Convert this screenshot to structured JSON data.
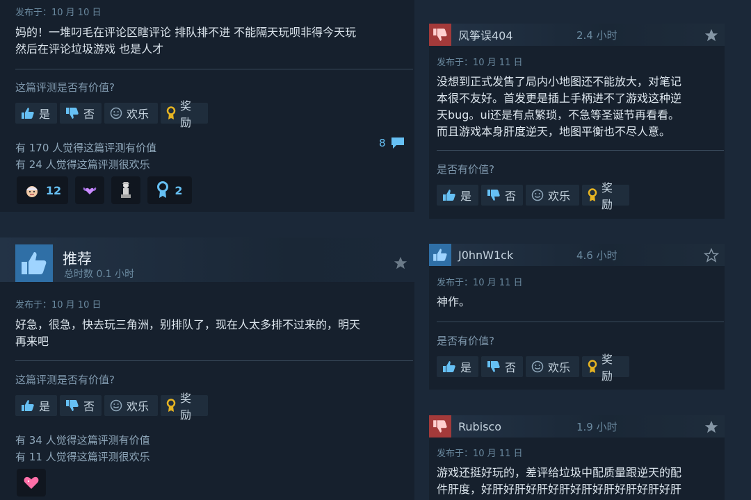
{
  "common": {
    "helpful_question": "这篇评测是否有价值?",
    "helpful_question_short": "是否有价值?",
    "btn_yes": "是",
    "btn_no": "否",
    "btn_funny": "欢乐",
    "btn_award": "奖励"
  },
  "left_review_1": {
    "posted": "发布于：10 月 10 日",
    "text_line1": "妈的！一堆叼毛在评论区瞎评论 排队排不进 不能隔天玩呗非得今天玩",
    "text_line2": "然后在评论垃圾游戏 也是人才",
    "helpful_count": "有 170 人觉得这篇评测有价值",
    "funny_count": "有 24 人觉得这篇评测很欢乐",
    "comment_count": "8",
    "awards": [
      {
        "icon": "face-award-icon",
        "count": "12"
      },
      {
        "icon": "heart-wings-award-icon",
        "count": ""
      },
      {
        "icon": "statue-award-icon",
        "count": ""
      },
      {
        "icon": "ribbon-award-icon",
        "count": "2"
      }
    ]
  },
  "left_review_2": {
    "verdict": "推荐",
    "hours": "总时数 0.1 小时",
    "posted": "发布于：10 月 10 日",
    "text_line1": "好急，很急，快去玩三角洲，别排队了，现在人太多排不过来的，明天",
    "text_line2": "再来吧",
    "helpful_count": "有 34 人觉得这篇评测有价值",
    "funny_count": "有 11 人觉得这篇评测很欢乐",
    "awards": [
      {
        "icon": "heart-award-icon",
        "count": ""
      }
    ]
  },
  "right_review_1": {
    "user": "风筝误404",
    "hours": "2.4 小时",
    "posted": "发布于：10 月 11 日",
    "text_line1": "没想到正式发售了局内小地图还不能放大，对笔记",
    "text_line2": "本很不友好。首发更是插上手柄进不了游戏这种逆",
    "text_line3": "天bug。ui还是有点繁琐，不急等圣诞节再看看。",
    "text_line4": "而且游戏本身肝度逆天，地图平衡也不尽人意。"
  },
  "right_review_2": {
    "user": "J0hnW1ck",
    "hours": "4.6 小时",
    "posted": "发布于：10 月 11 日",
    "text_line1": "神作。"
  },
  "right_review_3": {
    "user": "Rubisco",
    "hours": "1.9 小时",
    "posted": "发布于：10 月 11 日",
    "text_line1": "游戏还挺好玩的，差评给垃圾中配质量跟逆天的配",
    "text_line2": "件肝度，好肝好肝好肝好肝好肝好肝好肝好肝好肝"
  },
  "colors": {
    "background": "#1b2838",
    "panel": "#16202d",
    "accent_blue": "#66c0f4",
    "thumb_down": "#a33a3a",
    "thumb_up": "#2f6fa6"
  }
}
